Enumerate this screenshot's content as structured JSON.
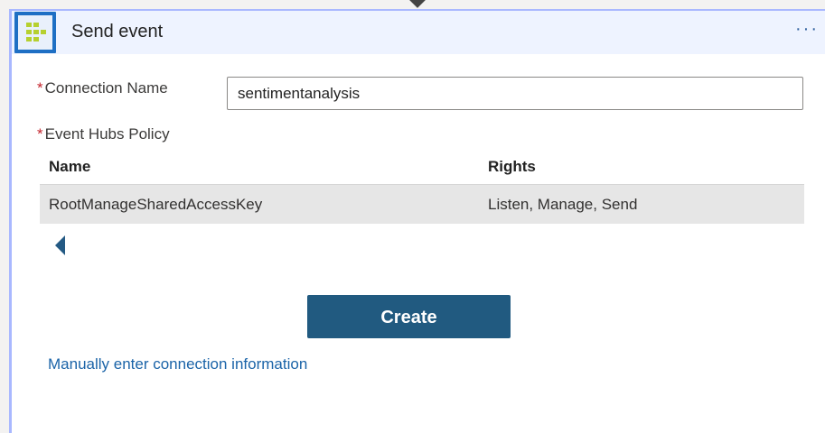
{
  "card": {
    "title": "Send event",
    "more_label": "···",
    "logo_icon": "event-hubs-icon"
  },
  "form": {
    "connection_name_label": "Connection Name",
    "connection_name_value": "sentimentanalysis",
    "policy_label": "Event Hubs Policy",
    "required_marker": "*"
  },
  "table": {
    "columns": [
      "Name",
      "Rights"
    ],
    "rows": [
      {
        "name": "RootManageSharedAccessKey",
        "rights": "Listen, Manage, Send"
      }
    ]
  },
  "actions": {
    "create_label": "Create",
    "manual_link": "Manually enter connection information"
  },
  "colors": {
    "accent": "#215a80",
    "link": "#1b64a8",
    "required": "#c4262e"
  }
}
